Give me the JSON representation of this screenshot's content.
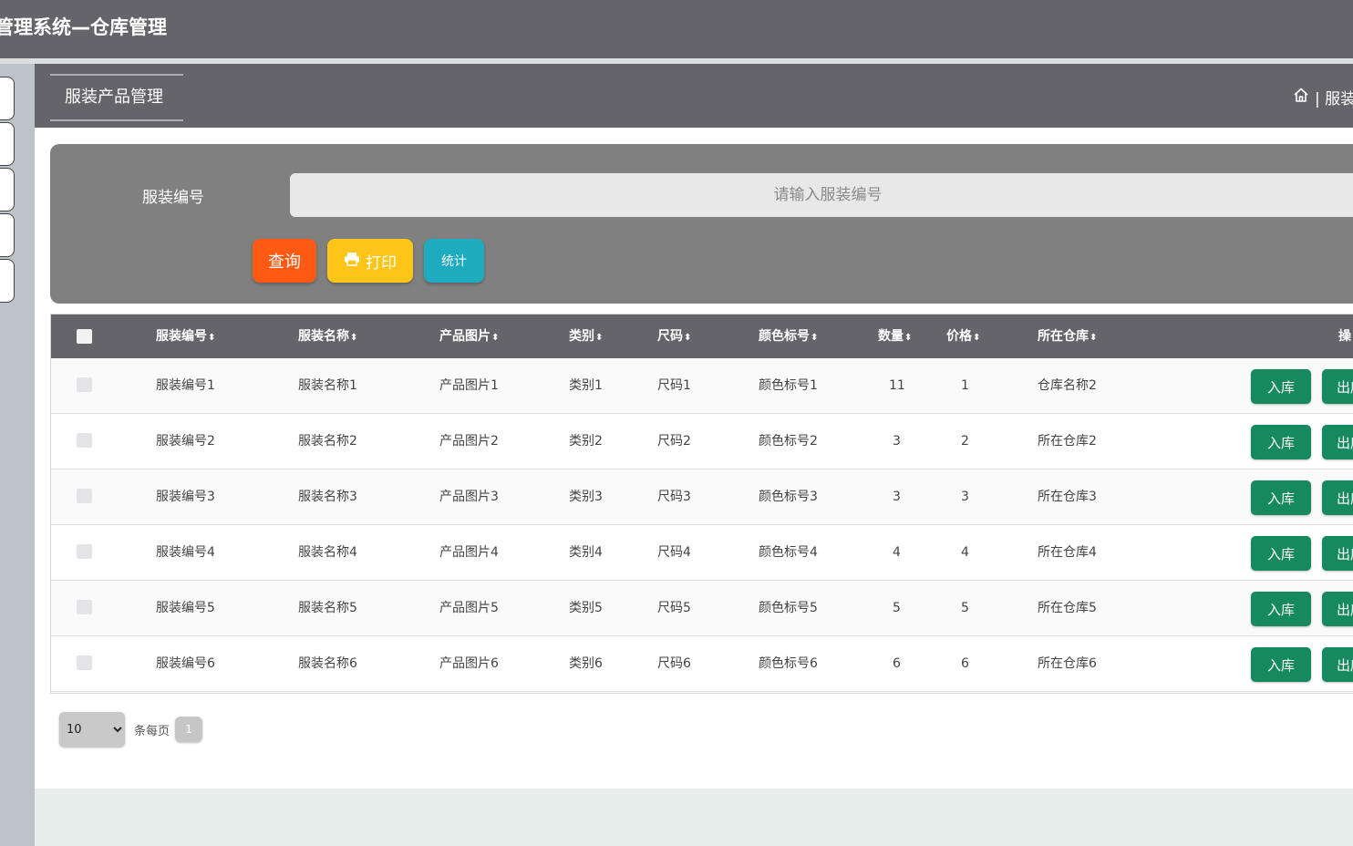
{
  "app": {
    "title": "管理系统—仓库管理"
  },
  "breadcrumb": {
    "page_tab": "服装产品管理",
    "right_text": "| 服装"
  },
  "search": {
    "label": "服装编号",
    "placeholder": "请输入服装编号",
    "query_label": "查询",
    "print_label": "打印",
    "stat_label": "统计"
  },
  "table": {
    "headers": [
      "服装编号",
      "服装名称",
      "产品图片",
      "类别",
      "尺码",
      "颜色标号",
      "数量",
      "价格",
      "所在仓库",
      "操"
    ],
    "sort_glyph": "⬍",
    "in_label": "入库",
    "out_label": "出库",
    "rows": [
      [
        "服装编号1",
        "服装名称1",
        "产品图片1",
        "类别1",
        "尺码1",
        "颜色标号1",
        "11",
        "1",
        "仓库名称2"
      ],
      [
        "服装编号2",
        "服装名称2",
        "产品图片2",
        "类别2",
        "尺码2",
        "颜色标号2",
        "3",
        "2",
        "所在仓库2"
      ],
      [
        "服装编号3",
        "服装名称3",
        "产品图片3",
        "类别3",
        "尺码3",
        "颜色标号3",
        "3",
        "3",
        "所在仓库3"
      ],
      [
        "服装编号4",
        "服装名称4",
        "产品图片4",
        "类别4",
        "尺码4",
        "颜色标号4",
        "4",
        "4",
        "所在仓库4"
      ],
      [
        "服装编号5",
        "服装名称5",
        "产品图片5",
        "类别5",
        "尺码5",
        "颜色标号5",
        "5",
        "5",
        "所在仓库5"
      ],
      [
        "服装编号6",
        "服装名称6",
        "产品图片6",
        "类别6",
        "尺码6",
        "颜色标号6",
        "6",
        "6",
        "所在仓库6"
      ]
    ]
  },
  "pager": {
    "page_size": "10",
    "page_size_options": [
      "10"
    ],
    "label": "条每页",
    "current_page": "1"
  },
  "colors": {
    "topbar": "#64646a",
    "query_button": "#ff5a13",
    "print_button": "#fcc518",
    "stat_button": "#1eaabf",
    "action_button": "#17895f"
  }
}
